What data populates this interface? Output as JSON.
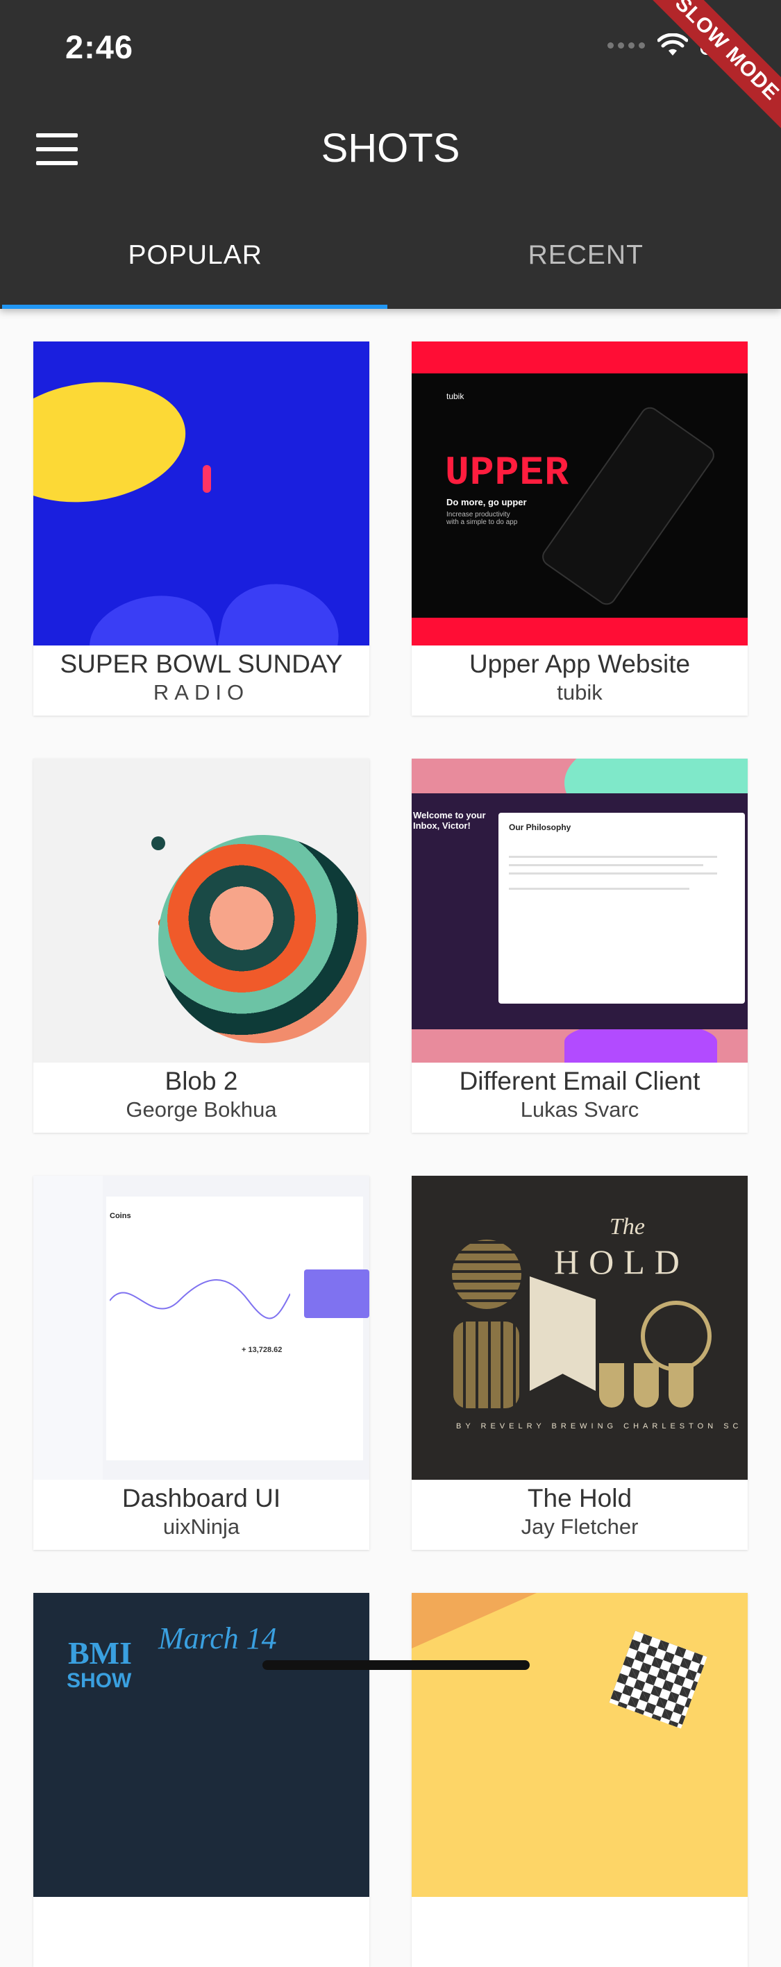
{
  "status_bar": {
    "time": "2:46",
    "battery_level": 0.7
  },
  "slow_mode_banner": "SLOW MODE",
  "app_bar": {
    "title": "SHOTS",
    "menu_icon": "hamburger-menu-icon"
  },
  "tabs": [
    {
      "label": "POPULAR",
      "selected": true
    },
    {
      "label": "RECENT",
      "selected": false
    }
  ],
  "colors": {
    "app_bar": "#303030",
    "tab_indicator": "#2196f3",
    "background": "#fafafa"
  },
  "shots": [
    {
      "title": "SUPER BOWL SUNDAY",
      "author": "RADIO"
    },
    {
      "title": "Upper App Website",
      "author": "tubik",
      "thumbnail_text": {
        "brand": "UPPER",
        "tagline": "Do more, go upper",
        "subtext": "Increase productivity with a simple to do app",
        "maker": "tubik"
      }
    },
    {
      "title": "Blob 2",
      "author": "George Bokhua"
    },
    {
      "title": "Different Email Client",
      "author": "Lukas Svarc",
      "thumbnail_text": {
        "welcome": "Welcome to your Inbox, Victor!",
        "heading": "Our Philosophy"
      }
    },
    {
      "title": "Dashboard UI",
      "author": "uixNinja",
      "thumbnail_text": {
        "heading": "Coins",
        "balance": "+ 13,728.62"
      }
    },
    {
      "title": "The Hold",
      "author": "Jay Fletcher",
      "thumbnail_text": {
        "the": "The",
        "hold": "HOLD",
        "footer": "BY REVELRY BREWING CHARLESTON SC"
      }
    },
    {
      "title": "",
      "author": "",
      "thumbnail_text": {
        "bmi": "BMI",
        "show": "SHOW",
        "march": "March 14"
      }
    },
    {
      "title": "",
      "author": ""
    }
  ]
}
